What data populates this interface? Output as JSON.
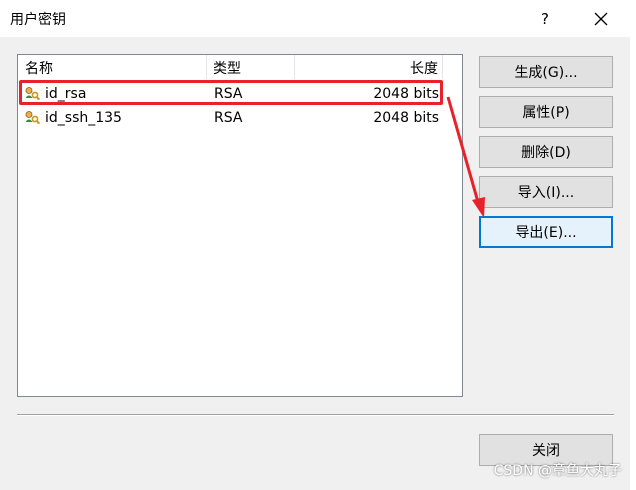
{
  "window": {
    "title": "用户密钥",
    "help_label": "?"
  },
  "list": {
    "columns": [
      "名称",
      "类型",
      "长度"
    ],
    "rows": [
      {
        "name": "id_rsa",
        "type": "RSA",
        "length": "2048 bits",
        "icon": "key-user-icon",
        "highlighted": true
      },
      {
        "name": "id_ssh_135",
        "type": "RSA",
        "length": "2048 bits",
        "icon": "key-user-icon",
        "highlighted": false
      }
    ]
  },
  "buttons": {
    "generate": "生成(G)...",
    "properties": "属性(P)",
    "delete": "删除(D)",
    "import": "导入(I)...",
    "export": "导出(E)...",
    "close": "关闭"
  },
  "annotation": {
    "color": "#e8222b"
  },
  "watermark": "CSDN @章鱼大丸子"
}
